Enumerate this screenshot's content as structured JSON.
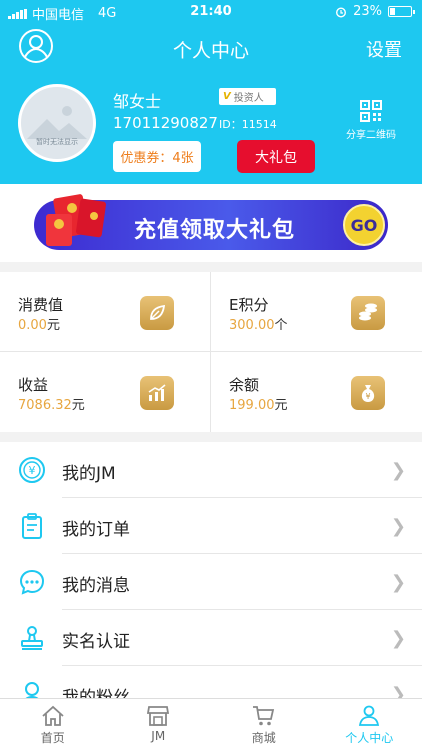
{
  "status_bar": {
    "carrier": "中国电信",
    "network": "4G",
    "time": "21:40",
    "battery": "23%",
    "battery_level": 0.23
  },
  "nav": {
    "title": "个人中心",
    "settings": "设置",
    "left_icon": "user-avatar-icon"
  },
  "profile": {
    "avatar_caption": "暂时无法显示",
    "name": "邹女士",
    "badge_label": "投资人",
    "badge_mark": "V",
    "phone": "17011290827",
    "id_label": "ID：",
    "id_value": "11514",
    "coupon": "优惠券：4张",
    "gift_button": "大礼包",
    "qr_label": "分享二维码"
  },
  "banner": {
    "text": "充值领取大礼包",
    "go": "GO"
  },
  "stats": [
    {
      "label": "消费值",
      "value": "0.00",
      "unit": "元",
      "icon": "leaf-icon"
    },
    {
      "label": "E积分",
      "value": "300.00",
      "unit": "个",
      "icon": "coins-icon"
    },
    {
      "label": "收益",
      "value": "7086.32",
      "unit": "元",
      "icon": "chart-icon"
    },
    {
      "label": "余额",
      "value": "199.00",
      "unit": "元",
      "icon": "money-bag-icon"
    }
  ],
  "menu": [
    {
      "label": "我的JM",
      "icon": "yen-coin-icon"
    },
    {
      "label": "我的订单",
      "icon": "clipboard-icon"
    },
    {
      "label": "我的消息",
      "icon": "chat-bubble-icon"
    },
    {
      "label": "实名认证",
      "icon": "stamp-icon"
    },
    {
      "label": "我的粉丝",
      "icon": "fans-icon"
    }
  ],
  "tabs": [
    {
      "label": "首页",
      "icon": "home-icon"
    },
    {
      "label": "JM",
      "icon": "store-icon"
    },
    {
      "label": "商城",
      "icon": "cart-icon"
    },
    {
      "label": "个人中心",
      "icon": "person-icon",
      "active": true
    }
  ],
  "colors": {
    "primary": "#1ec8f0",
    "gold": "#e7a640",
    "red": "#e60e2e",
    "banner": "#3d2ad0"
  }
}
